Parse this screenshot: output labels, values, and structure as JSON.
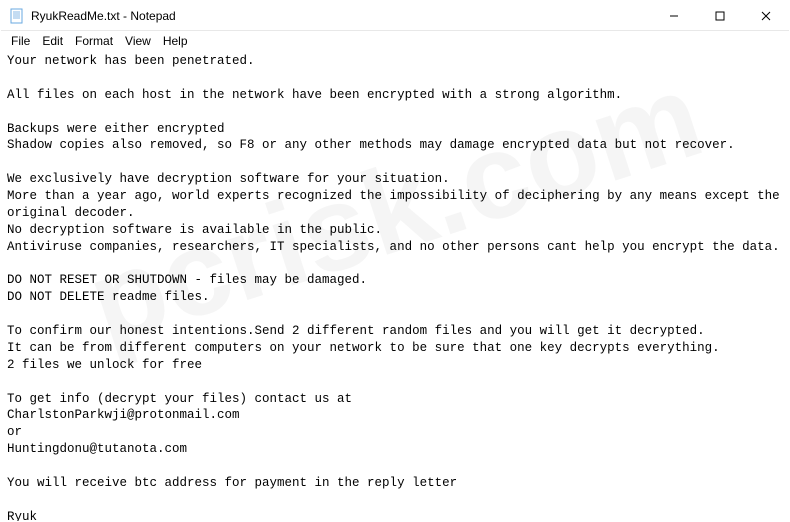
{
  "window": {
    "title": "RyukReadMe.txt - Notepad"
  },
  "menu": {
    "file": "File",
    "edit": "Edit",
    "format": "Format",
    "view": "View",
    "help": "Help"
  },
  "body_text": "Your network has been penetrated.\n\nAll files on each host in the network have been encrypted with a strong algorithm.\n\nBackups were either encrypted\nShadow copies also removed, so F8 or any other methods may damage encrypted data but not recover.\n\nWe exclusively have decryption software for your situation.\nMore than a year ago, world experts recognized the impossibility of deciphering by any means except the original decoder.\nNo decryption software is available in the public.\nAntiviruse companies, researchers, IT specialists, and no other persons cant help you encrypt the data.\n\nDO NOT RESET OR SHUTDOWN - files may be damaged.\nDO NOT DELETE readme files.\n\nTo confirm our honest intentions.Send 2 different random files and you will get it decrypted.\nIt can be from different computers on your network to be sure that one key decrypts everything.\n2 files we unlock for free\n\nTo get info (decrypt your files) contact us at\nCharlstonParkwji@protonmail.com\nor\nHuntingdonu@tutanota.com\n\nYou will receive btc address for payment in the reply letter\n\nRyuk\nNo system is safe",
  "watermark": "pcrisk.com"
}
